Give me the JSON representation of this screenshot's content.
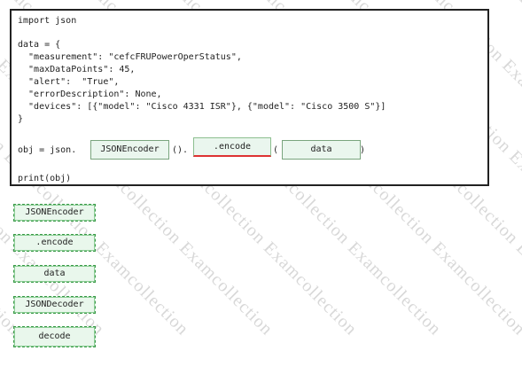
{
  "code_panel": {
    "line1": "import json",
    "line2": "data = {",
    "line3": "  \"measurement\": \"cefcFRUPowerOperStatus\",",
    "line4": "  \"maxDataPoints\": 45,",
    "line5": "  \"alert\":  \"True\",",
    "line6": "  \"errorDescription\": None,",
    "line7": "  \"devices\": [{\"model\": \"Cisco 4331 ISR\"}, {\"model\": \"Cisco 3500 S\"}]",
    "line8": "}",
    "obj_prefix": "obj = json.",
    "obj_paren1": "().",
    "obj_paren2": "(",
    "obj_paren3": ")",
    "print_line": "print(obj)"
  },
  "slots": {
    "slot1": "JSONEncoder",
    "slot2": ".encode",
    "slot3": "data"
  },
  "answer_options": [
    "JSONEncoder",
    ".encode",
    "data",
    "JSONDecoder",
    "decode"
  ],
  "watermark_text": "Examcollection"
}
